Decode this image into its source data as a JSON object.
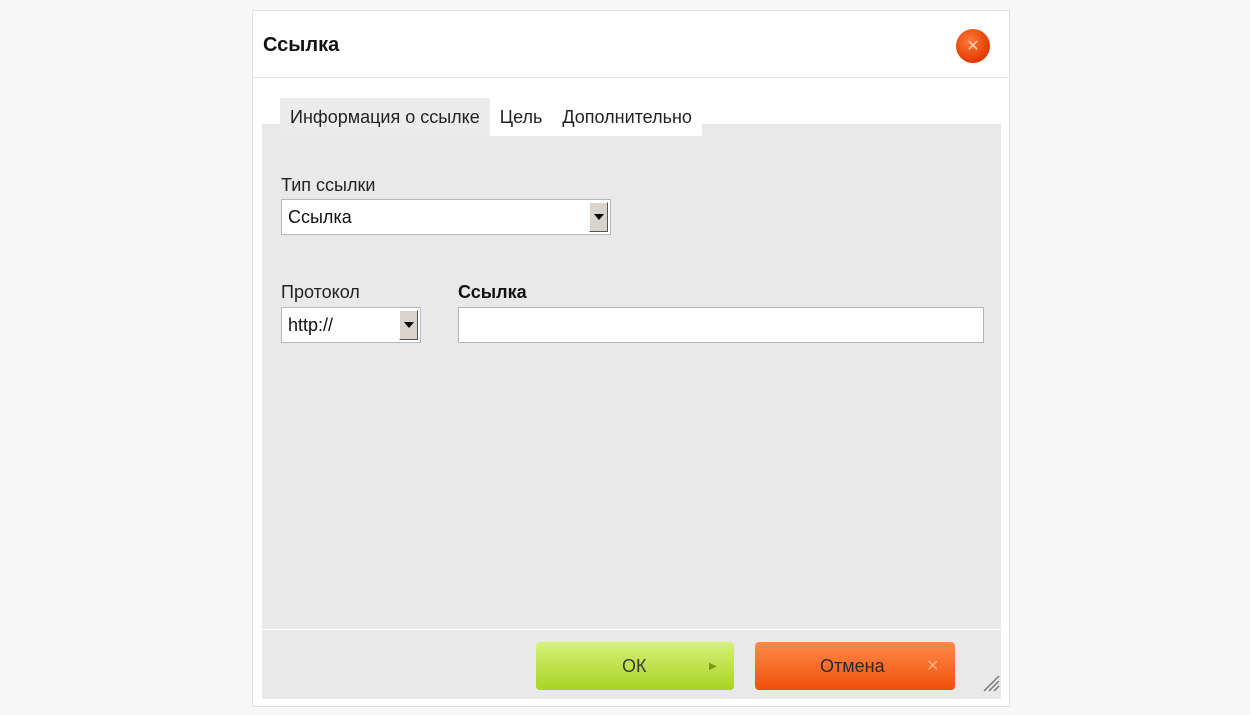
{
  "dialog": {
    "title": "Ссылка",
    "close_icon": "close-icon"
  },
  "tabs": [
    {
      "label": "Информация о ссылке",
      "active": true
    },
    {
      "label": "Цель",
      "active": false
    },
    {
      "label": "Дополнительно",
      "active": false
    }
  ],
  "form": {
    "link_type_label": "Тип ссылки",
    "link_type_value": "Ссылка",
    "protocol_label": "Протокол",
    "protocol_value": "http://",
    "url_label": "Ссылка",
    "url_value": ""
  },
  "buttons": {
    "ok_label": "ОК",
    "ok_icon": "triangle-right-icon",
    "cancel_label": "Отмена",
    "cancel_icon": "x-icon"
  },
  "colors": {
    "ok_green": "#b4dc2e",
    "cancel_orange": "#f5611a",
    "close_red": "#e8400a"
  }
}
